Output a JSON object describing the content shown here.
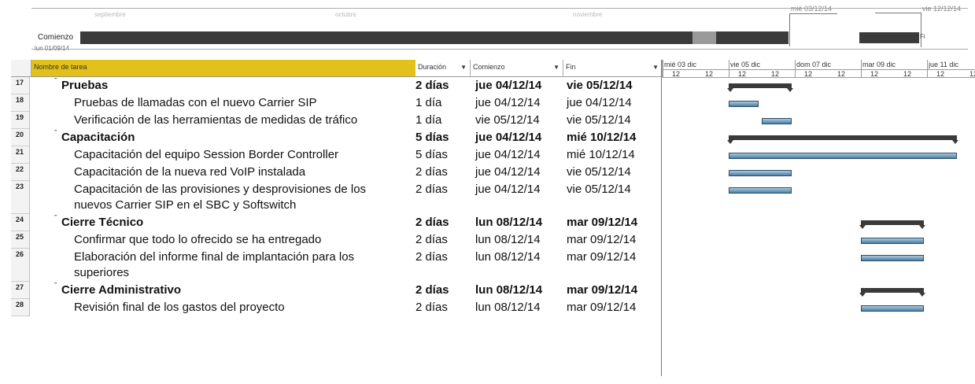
{
  "timeline": {
    "faint_labels": [
      "septiembre",
      "octubre",
      "noviembre"
    ],
    "label": "Comienzo",
    "start": "lun 01/09/14",
    "right_date_1": "mié 03/12/14",
    "right_date_2": "vie 12/12/14",
    "fin_label": "Fi"
  },
  "table": {
    "headers": {
      "name": "Nombre de tarea",
      "duration": "Duración",
      "start": "Comienzo",
      "end": "Fin"
    },
    "rows": [
      {
        "id": "17",
        "name": "Pruebas",
        "dur": "2 días",
        "start": "jue 04/12/14",
        "end": "vie 05/12/14",
        "summary": true
      },
      {
        "id": "18",
        "name": "Pruebas de llamadas con el nuevo Carrier SIP",
        "dur": "1 día",
        "start": "jue 04/12/14",
        "end": "jue 04/12/14",
        "summary": false
      },
      {
        "id": "19",
        "name": "Verificación de las herramientas de medidas de tráfico",
        "dur": "1 día",
        "start": "vie 05/12/14",
        "end": "vie 05/12/14",
        "summary": false
      },
      {
        "id": "20",
        "name": "Capacitación",
        "dur": "5 días",
        "start": "jue 04/12/14",
        "end": "mié 10/12/14",
        "summary": true
      },
      {
        "id": "21",
        "name": "Capacitación del equipo Session Border Controller",
        "dur": "5 días",
        "start": "jue 04/12/14",
        "end": "mié 10/12/14",
        "summary": false
      },
      {
        "id": "22",
        "name": "Capacitación de la nueva red VoIP instalada",
        "dur": "2 días",
        "start": "jue 04/12/14",
        "end": "vie 05/12/14",
        "summary": false
      },
      {
        "id": "23",
        "name": "Capacitación de las provisiones y desprovisiones de los",
        "name2": "nuevos Carrier SIP en el SBC y Softswitch",
        "dur": "2 días",
        "start": "jue 04/12/14",
        "end": "vie 05/12/14",
        "summary": false
      },
      {
        "id": "24",
        "name": "Cierre Técnico",
        "dur": "2 días",
        "start": "lun 08/12/14",
        "end": "mar 09/12/14",
        "summary": true
      },
      {
        "id": "25",
        "name": "Confirmar que todo lo ofrecido se ha entregado",
        "dur": "2 días",
        "start": "lun 08/12/14",
        "end": "mar 09/12/14",
        "summary": false
      },
      {
        "id": "26",
        "name": "Elaboración del informe final de implantación para los",
        "name2": "superiores",
        "dur": "2 días",
        "start": "lun 08/12/14",
        "end": "mar 09/12/14",
        "summary": false
      },
      {
        "id": "27",
        "name": "Cierre Administrativo",
        "dur": "2 días",
        "start": "lun 08/12/14",
        "end": "mar 09/12/14",
        "summary": true
      },
      {
        "id": "28",
        "name": "Revisión final de los gastos del proyecto",
        "dur": "2 días",
        "start": "lun 08/12/14",
        "end": "mar 09/12/14",
        "summary": false
      }
    ]
  },
  "gantt": {
    "weeks": [
      "mié 03 dic",
      "vie 05 dic",
      "dom 07 dic",
      "mar 09 dic",
      "jue 11 dic"
    ],
    "sub": [
      "12",
      "12",
      "12",
      "12",
      "12",
      "12",
      "12",
      "12",
      "12",
      "12"
    ],
    "colors": {
      "bar": "#5b8db2",
      "summary": "#3a3a3a"
    }
  }
}
